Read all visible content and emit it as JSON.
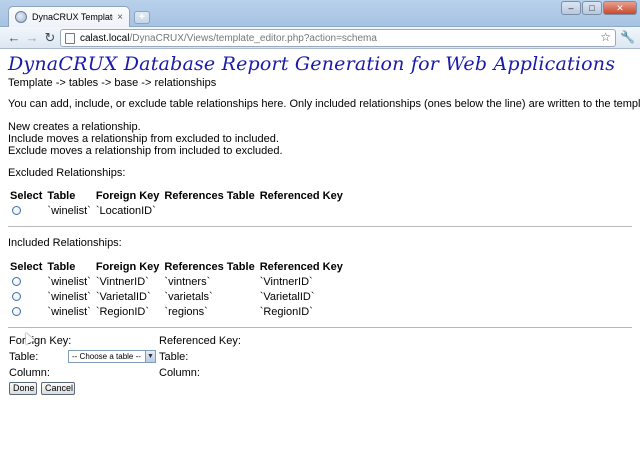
{
  "browser": {
    "tab_title": "DynaCRUX Template Editor",
    "tab_close": "×",
    "new_tab": "+",
    "url_host": "calast.local",
    "url_path": "/DynaCRUX/Views/template_editor.php?action=schema",
    "back": "←",
    "forward": "→",
    "reload": "↻",
    "star": "☆",
    "wrench": "🔧",
    "minimize": "–",
    "maximize": "□",
    "close": "✕"
  },
  "page": {
    "title": "DynaCRUX Database Report Generation for Web Applications",
    "breadcrumb": "Template -> tables -> base -> relationships",
    "intro": "You can add, include, or exclude table relationships here. Only included relationships (ones below the line) are written to the template.",
    "help_new": "New creates a relationship.",
    "help_include": "Include moves a relationship from excluded to included.",
    "help_exclude": "Exclude moves a relationship from included to excluded."
  },
  "columns": {
    "select": "Select",
    "table": "Table",
    "foreign_key": "Foreign Key",
    "references_table": "References Table",
    "referenced_key": "Referenced Key"
  },
  "excluded": {
    "heading": "Excluded Relationships:",
    "rows": [
      {
        "table": "`winelist`",
        "foreign_key": "`LocationID`",
        "references_table": "",
        "referenced_key": ""
      }
    ]
  },
  "included": {
    "heading": "Included Relationships:",
    "rows": [
      {
        "table": "`winelist`",
        "foreign_key": "`VintnerID`",
        "references_table": "`vintners`",
        "referenced_key": "`VintnerID`"
      },
      {
        "table": "`winelist`",
        "foreign_key": "`VarietalID`",
        "references_table": "`varietals`",
        "referenced_key": "`VarietalID`"
      },
      {
        "table": "`winelist`",
        "foreign_key": "`RegionID`",
        "references_table": "`regions`",
        "referenced_key": "`RegionID`"
      }
    ]
  },
  "form": {
    "foreign_key_label": "Foreign Key:",
    "referenced_key_label": "Referenced Key:",
    "table_label": "Table:",
    "column_label": "Column:",
    "table_select_value": "-- Choose a table --",
    "done_label": "Done",
    "cancel_label": "Cancel"
  }
}
